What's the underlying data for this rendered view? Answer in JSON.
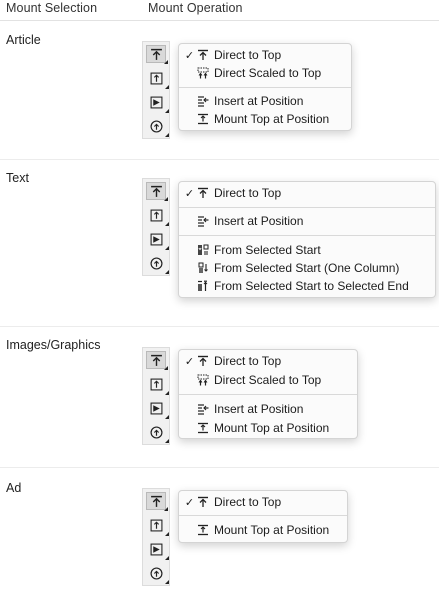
{
  "header": {
    "mount_selection": "Mount Selection",
    "mount_operation": "Mount Operation"
  },
  "sections": {
    "article": {
      "label": "Article",
      "items": {
        "direct_to_top": "Direct to Top",
        "direct_scaled_to_top": "Direct Scaled to Top",
        "insert_at_position": "Insert at Position",
        "mount_top_at_position": "Mount Top at Position"
      },
      "checked": "✓"
    },
    "text": {
      "label": "Text",
      "items": {
        "direct_to_top": "Direct to Top",
        "insert_at_position": "Insert at Position",
        "from_selected_start": "From Selected Start",
        "from_selected_start_one_column": "From Selected Start (One Column)",
        "from_selected_start_to_end": "From Selected Start to Selected End"
      },
      "checked": "✓"
    },
    "images": {
      "label": "Images/Graphics",
      "items": {
        "direct_to_top": "Direct to Top",
        "direct_scaled_to_top": "Direct Scaled to Top",
        "insert_at_position": "Insert at Position",
        "mount_top_at_position": "Mount Top at Position"
      },
      "checked": "✓"
    },
    "ad": {
      "label": "Ad",
      "items": {
        "direct_to_top": "Direct to Top",
        "mount_top_at_position": "Mount Top at Position"
      },
      "checked": "✓"
    }
  },
  "icons": {
    "toolbar": [
      "direct-to-top-icon",
      "insert-at-position-icon",
      "flag-icon",
      "mount-circle-icon"
    ]
  }
}
